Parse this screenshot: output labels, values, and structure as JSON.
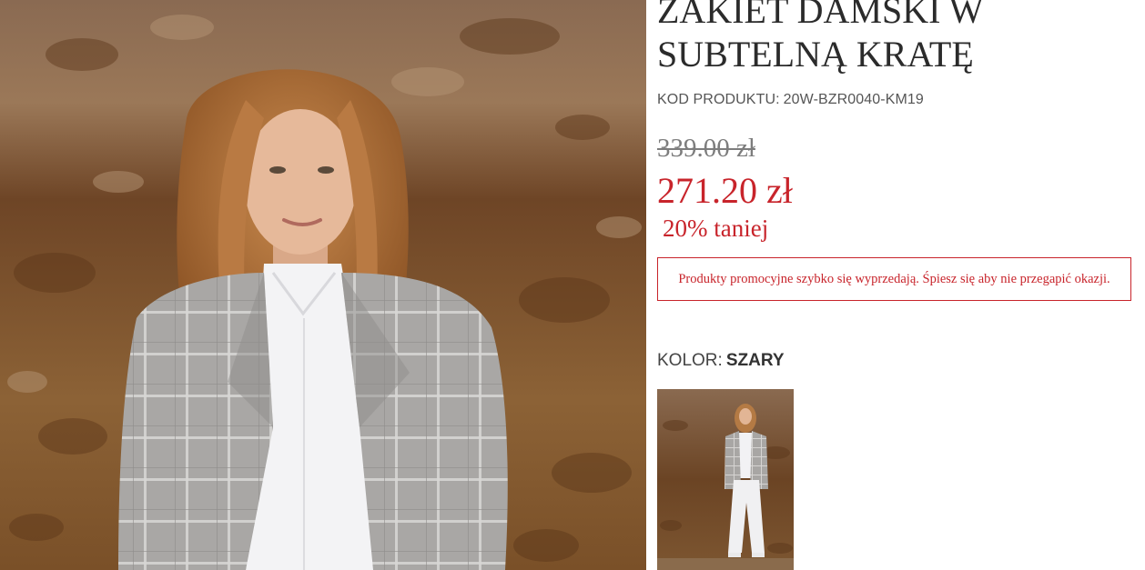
{
  "product": {
    "title": "ZAKIET DAMSKI W\nSUBTELNĄ KRATĘ",
    "sku_label": "KOD PRODUKTU:",
    "sku_value": "20W-BZR0040-KM19",
    "old_price": "339.00 zł",
    "new_price": "271.20 zł",
    "discount": "20% taniej",
    "promo_message": "Produkty promocyjne szybko się wyprzedają. Śpiesz się aby nie przegapić okazji.",
    "color_label": "KOLOR:",
    "color_value": "SZARY"
  },
  "colors": {
    "accent": "#c8242b",
    "text": "#2b2b2b",
    "muted": "#7d7d7d"
  }
}
